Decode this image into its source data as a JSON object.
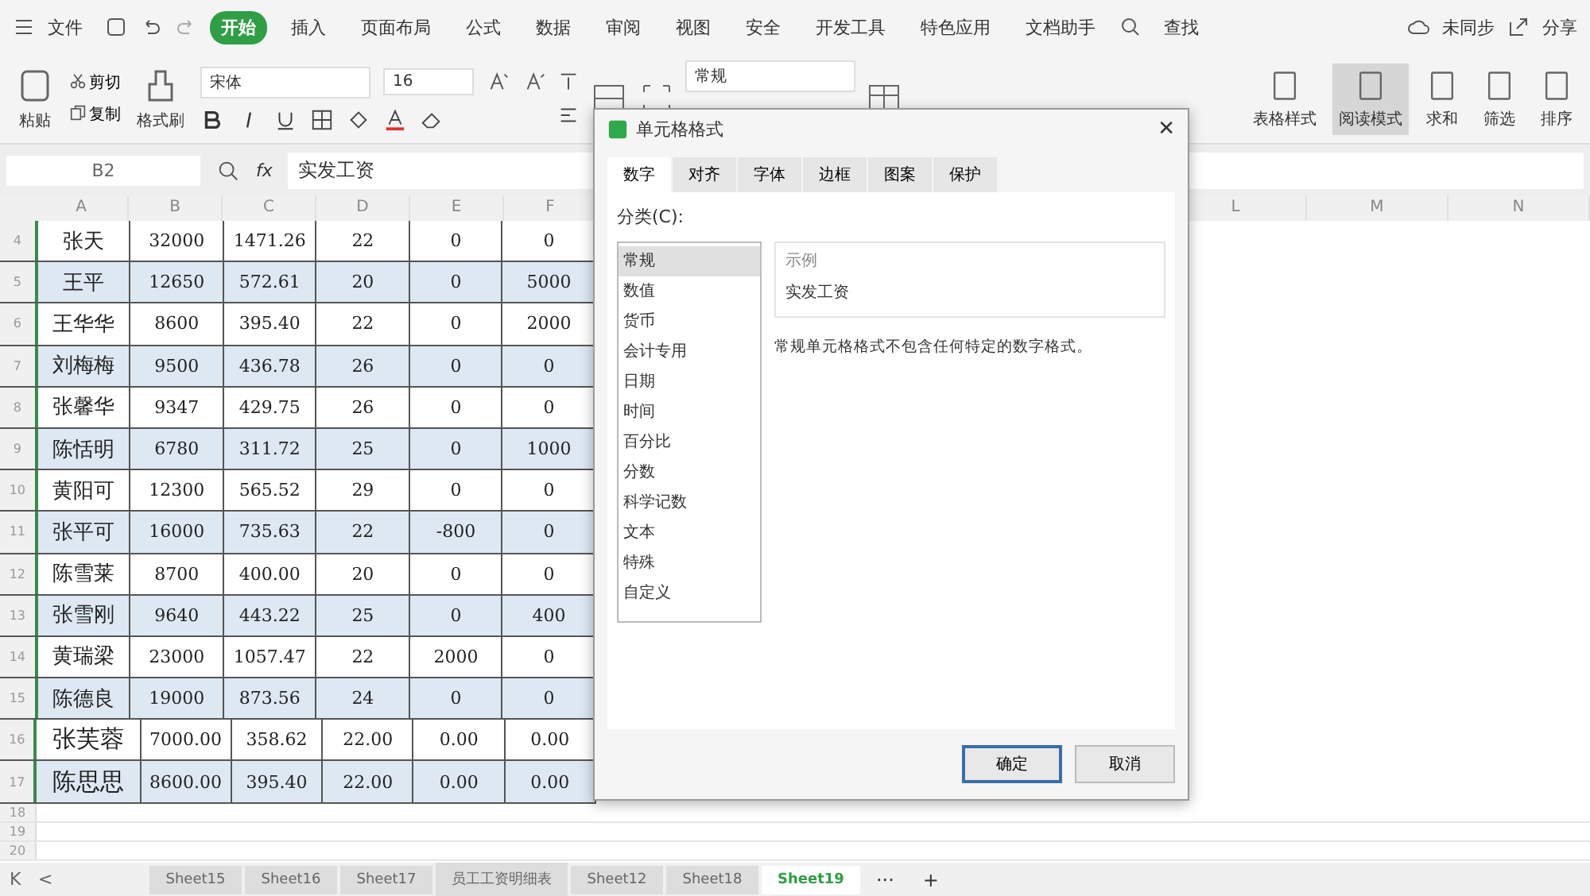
{
  "menu": {
    "file": "文件",
    "tabs": [
      {
        "label": "开始",
        "selected": true
      },
      {
        "label": "插入",
        "selected": false
      },
      {
        "label": "页面布局",
        "selected": false
      },
      {
        "label": "公式",
        "selected": false
      },
      {
        "label": "数据",
        "selected": false
      },
      {
        "label": "审阅",
        "selected": false
      },
      {
        "label": "视图",
        "selected": false
      },
      {
        "label": "安全",
        "selected": false
      },
      {
        "label": "开发工具",
        "selected": false
      },
      {
        "label": "特色应用",
        "selected": false
      },
      {
        "label": "文档助手",
        "selected": false
      }
    ],
    "search": "查找",
    "sync": "未同步",
    "share": "分享"
  },
  "ribbon": {
    "paste": "粘贴",
    "cut": "剪切",
    "copy": "复制",
    "format_painter": "格式刷",
    "font": "宋体",
    "size": "16",
    "number_format": "常规",
    "right_buttons": [
      {
        "label": "表格样式",
        "selected": false
      },
      {
        "label": "阅读模式",
        "selected": true
      },
      {
        "label": "求和",
        "selected": false
      },
      {
        "label": "筛选",
        "selected": false
      },
      {
        "label": "排序",
        "selected": false
      }
    ]
  },
  "formula_bar": {
    "cell": "B2",
    "fx": "fx",
    "value": "实发工资"
  },
  "columns": [
    "A",
    "B",
    "C",
    "D",
    "E",
    "F"
  ],
  "far_columns": [
    "L",
    "M",
    "N"
  ],
  "rows": [
    {
      "n": "4",
      "cells": [
        "张天",
        "32000",
        "1471.26",
        "22",
        "0",
        "0"
      ]
    },
    {
      "n": "5",
      "cells": [
        "王平",
        "12650",
        "572.61",
        "20",
        "0",
        "5000"
      ]
    },
    {
      "n": "6",
      "cells": [
        "王华华",
        "8600",
        "395.40",
        "22",
        "0",
        "2000"
      ]
    },
    {
      "n": "7",
      "cells": [
        "刘梅梅",
        "9500",
        "436.78",
        "26",
        "0",
        "0"
      ]
    },
    {
      "n": "8",
      "cells": [
        "张馨华",
        "9347",
        "429.75",
        "26",
        "0",
        "0"
      ]
    },
    {
      "n": "9",
      "cells": [
        "陈恬明",
        "6780",
        "311.72",
        "25",
        "0",
        "1000"
      ]
    },
    {
      "n": "10",
      "cells": [
        "黄阳可",
        "12300",
        "565.52",
        "29",
        "0",
        "0"
      ]
    },
    {
      "n": "11",
      "cells": [
        "张平可",
        "16000",
        "735.63",
        "22",
        "-800",
        "0"
      ]
    },
    {
      "n": "12",
      "cells": [
        "陈雪莱",
        "8700",
        "400.00",
        "20",
        "0",
        "0"
      ]
    },
    {
      "n": "13",
      "cells": [
        "张雪刚",
        "9640",
        "443.22",
        "25",
        "0",
        "400"
      ]
    },
    {
      "n": "14",
      "cells": [
        "黄瑞梁",
        "23000",
        "1057.47",
        "22",
        "2000",
        "0"
      ]
    },
    {
      "n": "15",
      "cells": [
        "陈德良",
        "19000",
        "873.56",
        "24",
        "0",
        "0"
      ]
    },
    {
      "n": "16",
      "cells": [
        "张芙蓉",
        "7000.00",
        "358.62",
        "22.00",
        "0.00",
        "0.00"
      ]
    },
    {
      "n": "17",
      "cells": [
        "陈思思",
        "8600.00",
        "395.40",
        "22.00",
        "0.00",
        "0.00"
      ]
    }
  ],
  "empty_rows": [
    "18",
    "19",
    "20"
  ],
  "dialog": {
    "title": "单元格格式",
    "tabs": [
      {
        "label": "数字",
        "selected": true
      },
      {
        "label": "对齐",
        "selected": false
      },
      {
        "label": "字体",
        "selected": false
      },
      {
        "label": "边框",
        "selected": false
      },
      {
        "label": "图案",
        "selected": false
      },
      {
        "label": "保护",
        "selected": false
      }
    ],
    "category_label": "分类(C):",
    "categories": [
      {
        "label": "常规",
        "selected": true
      },
      {
        "label": "数值",
        "selected": false
      },
      {
        "label": "货币",
        "selected": false
      },
      {
        "label": "会计专用",
        "selected": false
      },
      {
        "label": "日期",
        "selected": false
      },
      {
        "label": "时间",
        "selected": false
      },
      {
        "label": "百分比",
        "selected": false
      },
      {
        "label": "分数",
        "selected": false
      },
      {
        "label": "科学记数",
        "selected": false
      },
      {
        "label": "文本",
        "selected": false
      },
      {
        "label": "特殊",
        "selected": false
      },
      {
        "label": "自定义",
        "selected": false
      }
    ],
    "close": "✕",
    "sample_label": "示例",
    "sample": "实发工资",
    "description": "常规单元格格式不包含任何特定的数字格式。",
    "ok": "确定",
    "cancel": "取消"
  },
  "sheets": [
    {
      "label": "Sheet15",
      "selected": false
    },
    {
      "label": "Sheet16",
      "selected": false
    },
    {
      "label": "Sheet17",
      "selected": false
    },
    {
      "label": "员工工资明细表",
      "selected": false
    },
    {
      "label": "Sheet12",
      "selected": false
    },
    {
      "label": "Sheet18",
      "selected": false
    },
    {
      "label": "Sheet19",
      "selected": true
    }
  ],
  "sheet_first": "K",
  "sheet_prev": "<",
  "sheet_more": "···",
  "sheet_add": "+"
}
